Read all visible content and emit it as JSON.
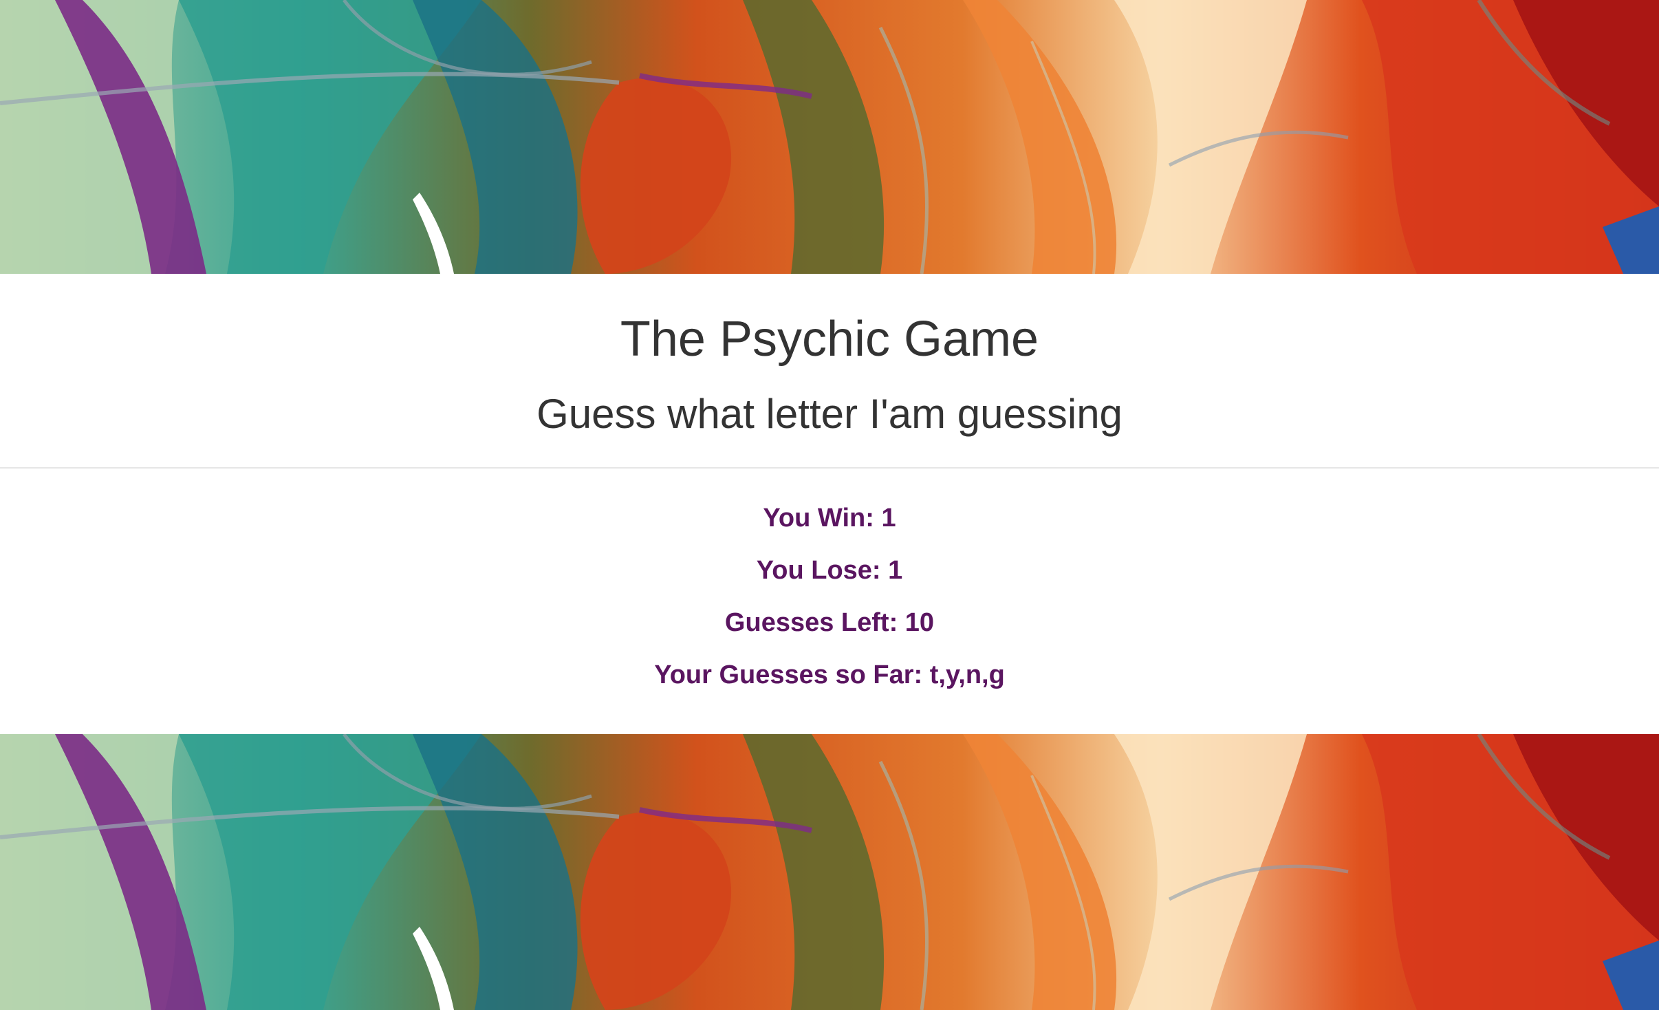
{
  "header": {
    "title": "The Psychic Game",
    "subtitle": "Guess what letter I'am guessing"
  },
  "stats": {
    "wins_label": "You Win: ",
    "wins": "1",
    "losses_label": "You Lose: ",
    "losses": "1",
    "guesses_left_label": "Guesses Left: ",
    "guesses_left": "10",
    "guesses_so_far_label": "Your Guesses so Far: ",
    "guesses_so_far": "t,y,n,g"
  },
  "colors": {
    "title_text": "#333333",
    "stat_text": "#5a1560",
    "background_art": [
      "#8fb89a",
      "#2a9e8c",
      "#1f6e7a",
      "#6b6a2a",
      "#d9581e",
      "#f0a060",
      "#c4201c",
      "#7a2a7a"
    ]
  },
  "icons": {
    "background": "abstract-painting-background"
  }
}
